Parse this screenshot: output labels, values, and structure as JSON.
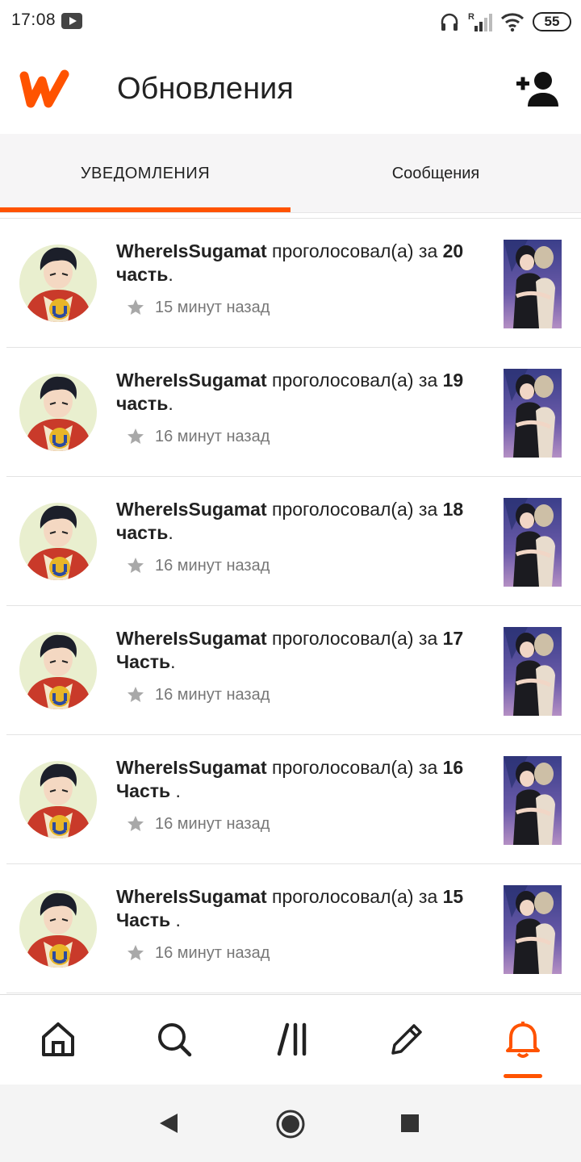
{
  "status_bar": {
    "time": "17:08",
    "battery": "55"
  },
  "header": {
    "title": "Обновления"
  },
  "tabs": [
    {
      "label": "УВЕДОМЛЕНИЯ"
    },
    {
      "label": "Сообщения"
    }
  ],
  "notifications": [
    {
      "user": "WhereIsSugamat",
      "action": "проголосовал(а) за",
      "part": "20 часть",
      "suffix": ".",
      "time": "15 минут назад"
    },
    {
      "user": "WhereIsSugamat",
      "action": "проголосовал(а) за",
      "part": "19 часть",
      "suffix": ".",
      "time": "16 минут назад"
    },
    {
      "user": "WhereIsSugamat",
      "action": "проголосовал(а) за",
      "part": "18 часть",
      "suffix": ".",
      "time": "16 минут назад"
    },
    {
      "user": "WhereIsSugamat",
      "action": "проголосовал(а) за",
      "part": "17 Часть",
      "suffix": ".",
      "time": "16 минут назад"
    },
    {
      "user": "WhereIsSugamat",
      "action": "проголосовал(а) за",
      "part": "16 Часть",
      "suffix": " .",
      "time": "16 минут назад"
    },
    {
      "user": "WhereIsSugamat",
      "action": "проголосовал(а) за",
      "part": "15 Часть",
      "suffix": " .",
      "time": "16 минут назад"
    }
  ],
  "bottom_nav": [
    {
      "icon": "home-icon"
    },
    {
      "icon": "search-icon"
    },
    {
      "icon": "library-icon"
    },
    {
      "icon": "pencil-icon"
    },
    {
      "icon": "bell-icon",
      "active": true
    }
  ],
  "colors": {
    "accent": "#ff5300",
    "text": "#222222",
    "muted": "#777777",
    "tab_bg": "#f6f5f6"
  }
}
